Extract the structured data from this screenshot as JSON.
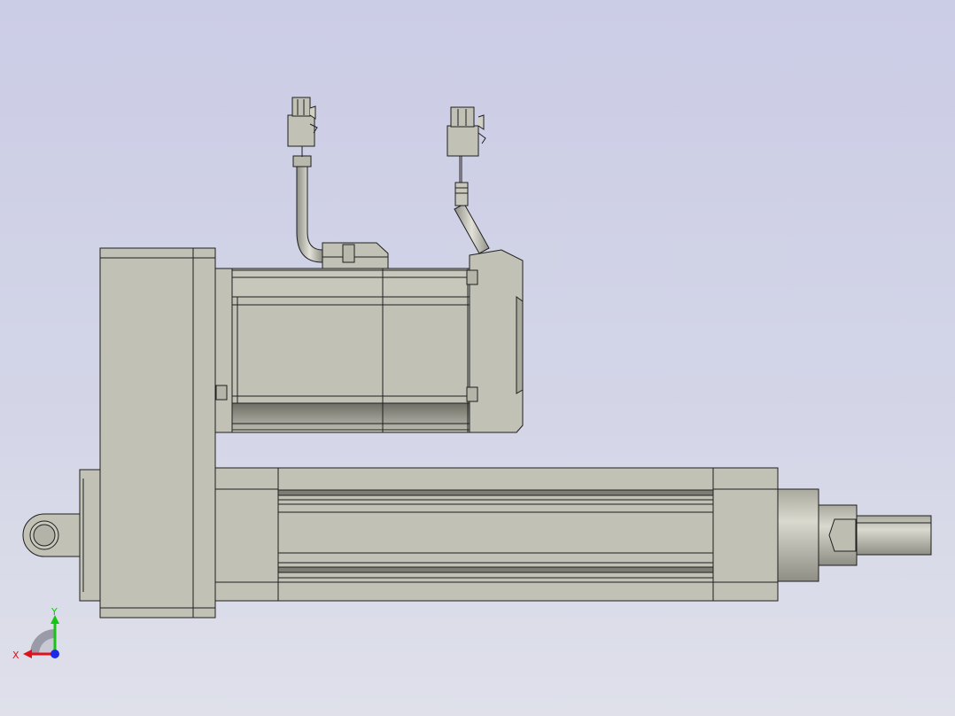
{
  "viewport": {
    "background_top": "#cbcce6",
    "background_bottom": "#dfe0ea"
  },
  "model": {
    "body_color": "#c1c1b6",
    "edge_color": "#1f1f1f",
    "components": [
      "pivot-eye",
      "rear-housing",
      "motor",
      "power-cable",
      "encoder-cable",
      "actuator-tube",
      "front-cap",
      "rod-end"
    ]
  },
  "triad": {
    "x_label": "X",
    "y_label": "Y",
    "x_color": "#e0101c",
    "y_color": "#16c416",
    "z_color": "#1c2ae8"
  }
}
